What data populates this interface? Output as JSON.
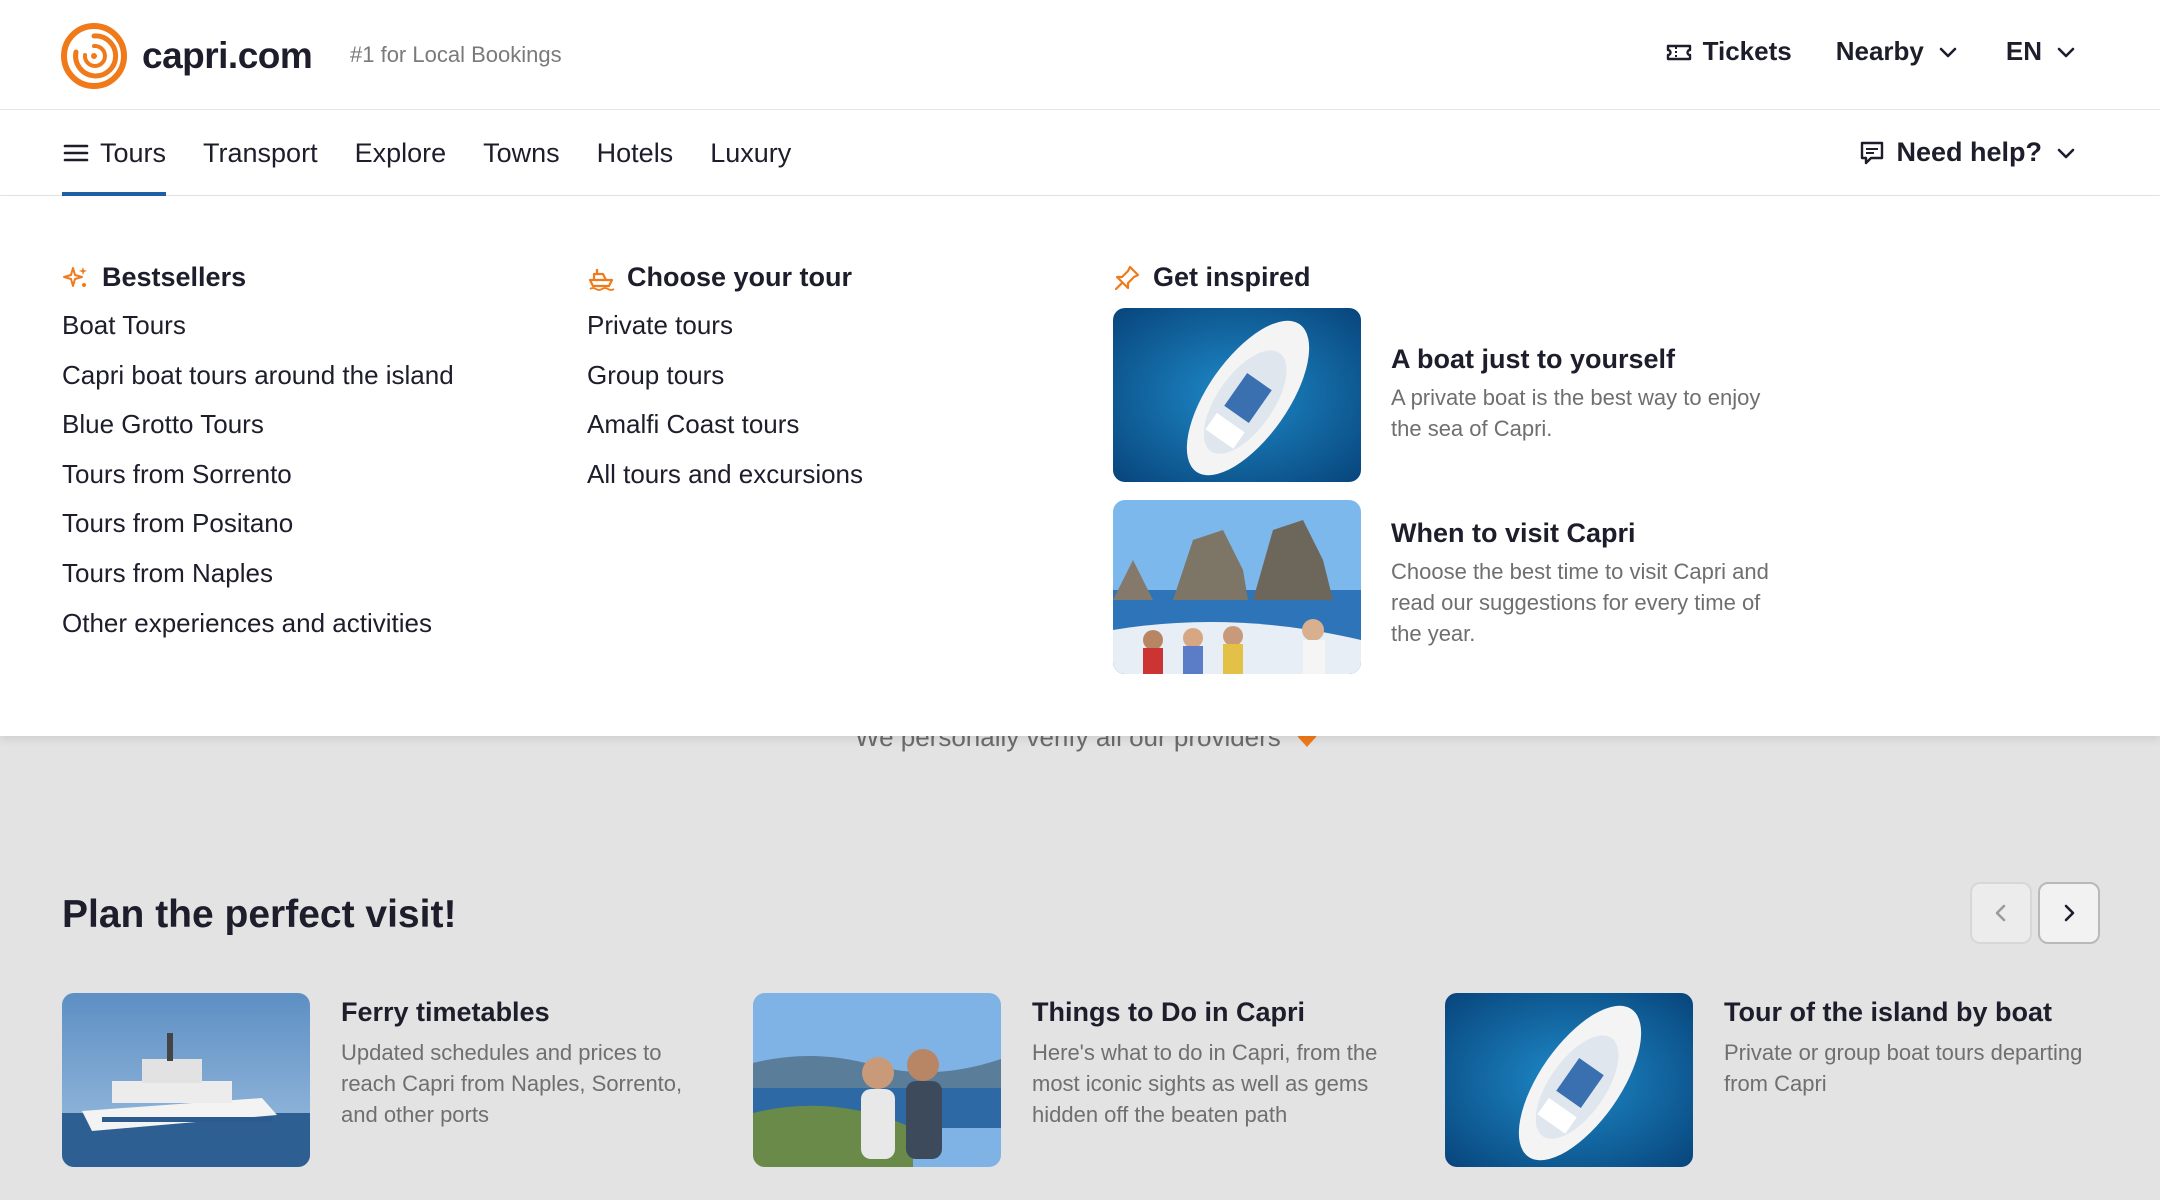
{
  "header": {
    "logo_text": "capri.com",
    "tagline": "#1 for Local Bookings",
    "tickets_label": "Tickets",
    "nearby_label": "Nearby",
    "language_label": "EN",
    "brand_color": "#f07a1a"
  },
  "nav": {
    "items": [
      {
        "label": "Tours",
        "active": true
      },
      {
        "label": "Transport"
      },
      {
        "label": "Explore"
      },
      {
        "label": "Towns"
      },
      {
        "label": "Hotels"
      },
      {
        "label": "Luxury"
      }
    ],
    "help_label": "Need help?",
    "active_color": "#1f5fa6"
  },
  "mega_menu": {
    "bestsellers": {
      "title": "Bestsellers",
      "icon": "sparkles-icon",
      "links": [
        "Boat Tours",
        "Capri boat tours around the island",
        "Blue Grotto Tours",
        "Tours from Sorrento",
        "Tours from Positano",
        "Tours from Naples",
        "Other experiences and activities"
      ]
    },
    "choose": {
      "title": "Choose your tour",
      "icon": "boat-icon",
      "links": [
        "Private tours",
        "Group tours",
        "Amalfi Coast tours",
        "All tours and excursions"
      ]
    },
    "inspired": {
      "title": "Get inspired",
      "icon": "pin-icon",
      "items": [
        {
          "title": "A boat just to yourself",
          "desc": "A private boat is the best way to enjoy the sea of Capri."
        },
        {
          "title": "When to visit Capri",
          "desc": "Choose the best time to visit Capri and read our suggestions for every time of the year."
        }
      ]
    }
  },
  "page": {
    "verify_text": "We personally verify all our providers",
    "section_title": "Plan the perfect visit!",
    "cards": [
      {
        "title": "Ferry timetables",
        "desc": "Updated schedules and prices to reach Capri from Naples, Sorrento, and other ports"
      },
      {
        "title": "Things to Do in Capri",
        "desc": "Here's what to do in Capri, from the most iconic sights as well as gems hidden off the beaten path"
      },
      {
        "title": "Tour of the island by boat",
        "desc": "Private or group boat tours departing from Capri"
      }
    ]
  }
}
